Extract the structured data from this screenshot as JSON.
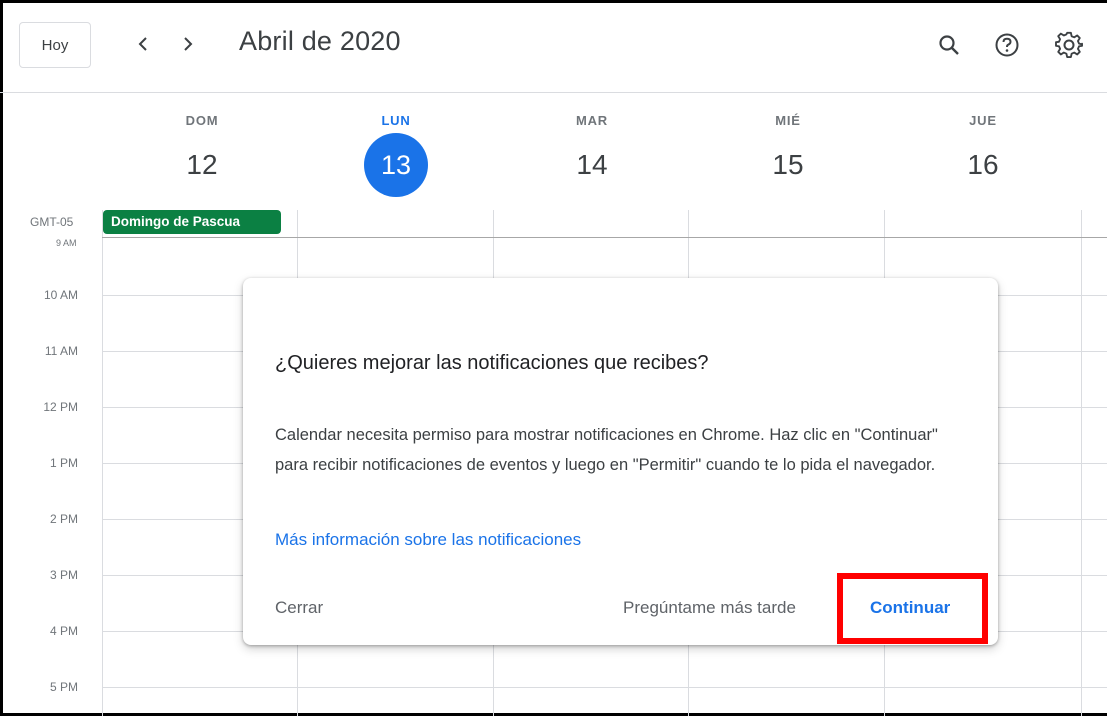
{
  "header": {
    "today_label": "Hoy",
    "month_title": "Abril de 2020",
    "icons": [
      "chevron-left-icon",
      "chevron-right-icon",
      "search-icon",
      "help-icon",
      "gear-icon"
    ]
  },
  "days": [
    {
      "name": "DOM",
      "number": "12",
      "today": false
    },
    {
      "name": "LUN",
      "number": "13",
      "today": true
    },
    {
      "name": "MAR",
      "number": "14",
      "today": false
    },
    {
      "name": "MIÉ",
      "number": "15",
      "today": false
    },
    {
      "name": "JUE",
      "number": "16",
      "today": false
    }
  ],
  "grid": {
    "timezone": "GMT-05",
    "partial_hour": "9 AM",
    "hours": [
      "10 AM",
      "11 AM",
      "12 PM",
      "1 PM",
      "2 PM",
      "3 PM",
      "4 PM",
      "5 PM"
    ]
  },
  "all_day_event": "Domingo de Pascua",
  "dialog": {
    "title": "¿Quieres mejorar las notificaciones que recibes?",
    "body": "Calendar necesita permiso para mostrar notificaciones en Chrome. Haz clic en \"Continuar\" para recibir notificaciones de eventos y luego en \"Permitir\" cuando te lo pida el navegador.",
    "link": "Más información sobre las notificaciones",
    "close_label": "Cerrar",
    "later_label": "Pregúntame más tarde",
    "continue_label": "Continuar"
  },
  "colors": {
    "accent": "#1a73e8",
    "event": "#0b8043",
    "highlight": "#ff0000"
  }
}
